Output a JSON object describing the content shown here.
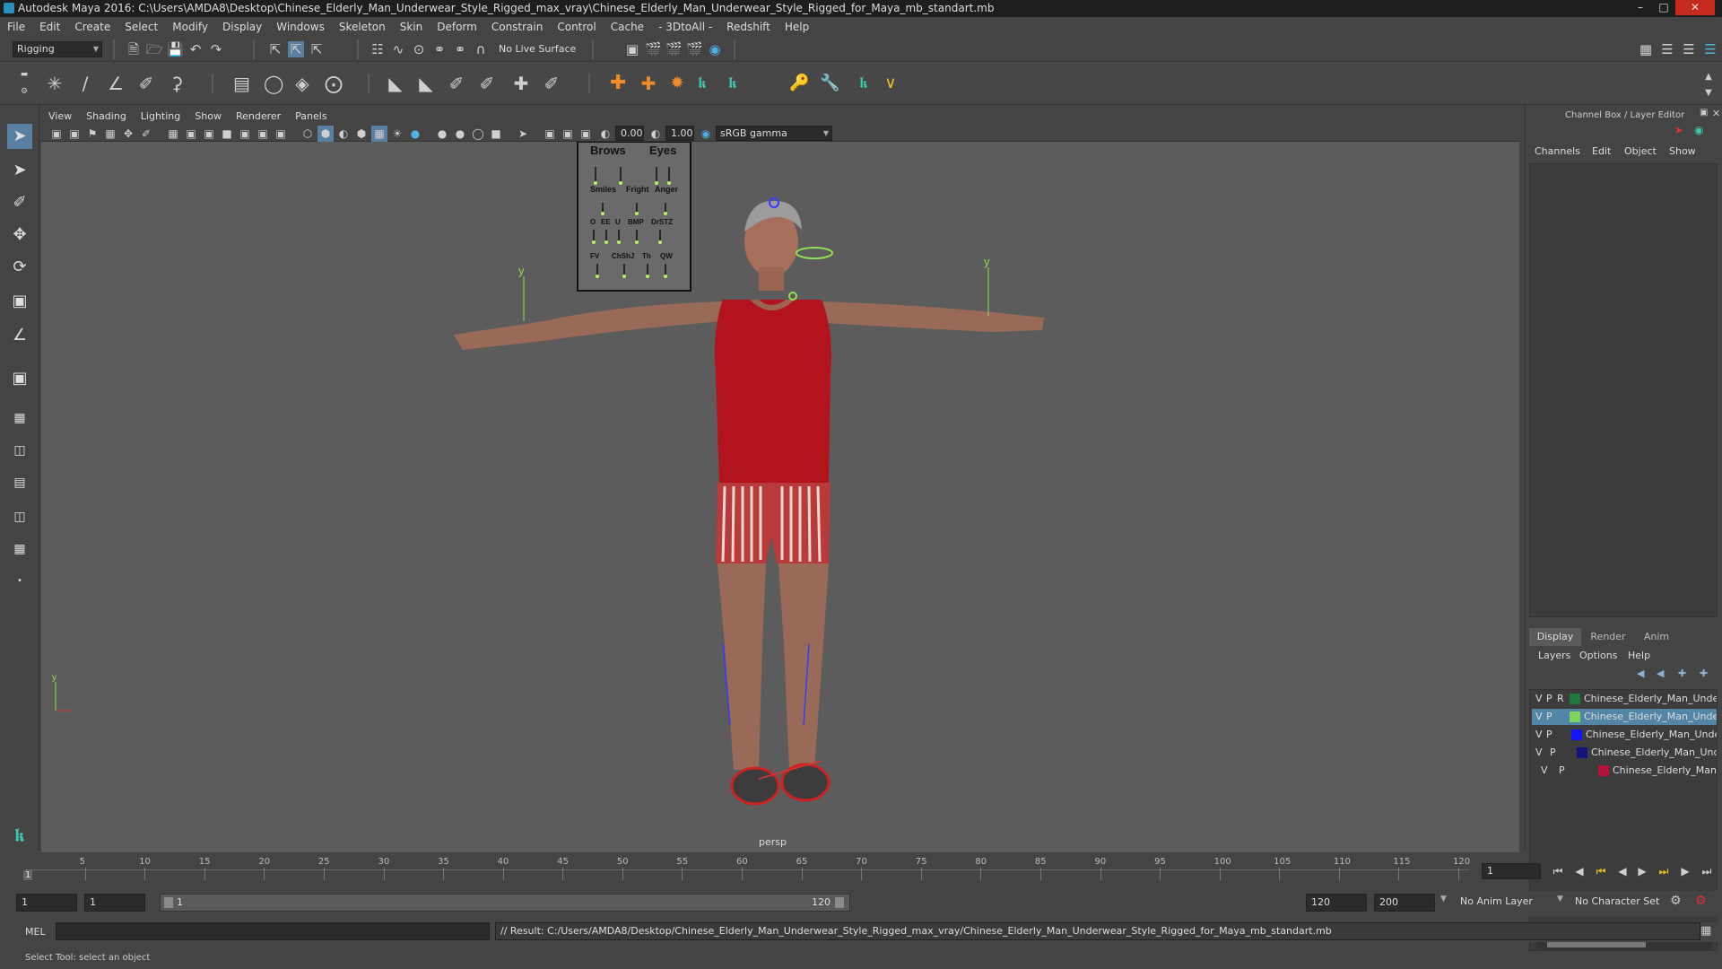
{
  "window": {
    "title": "Autodesk Maya 2016: C:\\Users\\AMDA8\\Desktop\\Chinese_Elderly_Man_Underwear_Style_Rigged_max_vray\\Chinese_Elderly_Man_Underwear_Style_Rigged_for_Maya_mb_standart.mb"
  },
  "menubar": [
    "File",
    "Edit",
    "Create",
    "Select",
    "Modify",
    "Display",
    "Windows",
    "Skeleton",
    "Skin",
    "Deform",
    "Constrain",
    "Control",
    "Cache",
    "- 3DtoAll -",
    "Redshift",
    "Help"
  ],
  "shelf": {
    "mode": "Rigging",
    "live_surface": "No Live Surface"
  },
  "viewport": {
    "menus": [
      "View",
      "Shading",
      "Lighting",
      "Show",
      "Renderer",
      "Panels"
    ],
    "exposure": "0.00",
    "gamma": "1.00",
    "color_space": "sRGB gamma",
    "camera_label": "persp",
    "face_panel": {
      "row1": [
        "Brows",
        "Eyes"
      ],
      "row2": [
        "Smiles",
        "Fright",
        "Anger"
      ],
      "row3": [
        "O",
        "EE",
        "U",
        "BMP",
        "DrSTZ"
      ],
      "row4": [
        "FV",
        "ChShJ",
        "Th",
        "QW"
      ]
    },
    "axis_y": "y"
  },
  "channelbox": {
    "title": "Channel Box / Layer Editor",
    "menus": [
      "Channels",
      "Edit",
      "Object",
      "Show"
    ],
    "tabs": [
      "Display",
      "Render",
      "Anim"
    ],
    "layer_menus": [
      "Layers",
      "Options",
      "Help"
    ],
    "layers": [
      {
        "v": "V",
        "p": "P",
        "r": "R",
        "name": "Chinese_Elderly_Man_Under",
        "color": "#1e7a3a",
        "selected": false
      },
      {
        "v": "V",
        "p": "P",
        "r": "",
        "name": "Chinese_Elderly_Man_Under",
        "color": "#7bd65a",
        "selected": true
      },
      {
        "v": "V",
        "p": "P",
        "r": "",
        "name": "Chinese_Elderly_Man_Under",
        "color": "#1414ff",
        "selected": false
      },
      {
        "v": "V",
        "p": "P",
        "r": "",
        "name": "Chinese_Elderly_Man_Unde",
        "color": "#141480",
        "selected": false
      },
      {
        "v": "V",
        "p": "P",
        "r": "",
        "name": "Chinese_Elderly_Man_",
        "color": "#b3133a",
        "selected": false
      }
    ]
  },
  "timeline": {
    "ticks": [
      "5",
      "10",
      "15",
      "20",
      "25",
      "30",
      "35",
      "40",
      "45",
      "50",
      "55",
      "60",
      "65",
      "70",
      "75",
      "80",
      "85",
      "90",
      "95",
      "100",
      "105",
      "110",
      "115",
      "120"
    ],
    "current_frame": "1",
    "frame_field": "1"
  },
  "range": {
    "start": "1",
    "playback_start": "1",
    "slider_start": "1",
    "slider_end": "120",
    "playback_end": "120",
    "end": "200",
    "anim_layer": "No Anim Layer",
    "char_set": "No Character Set"
  },
  "cmdline": {
    "lang": "MEL",
    "result": "// Result: C:/Users/AMDA8/Desktop/Chinese_Elderly_Man_Underwear_Style_Rigged_max_vray/Chinese_Elderly_Man_Underwear_Style_Rigged_for_Maya_mb_standart.mb"
  },
  "helpline": "Select Tool: select an object"
}
